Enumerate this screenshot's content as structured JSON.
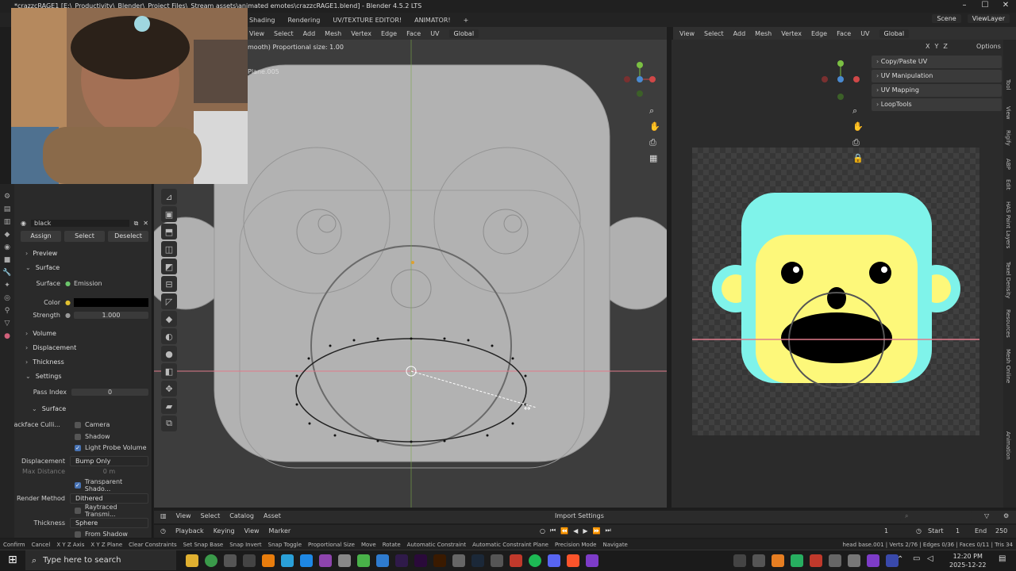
{
  "title_bar": {
    "title": "*crazzcRAGE1 [E:\\_Productivity\\_Blender\\_Project Files\\_Stream assets\\animated emotes\\crazzcRAGE1.blend] - Blender 4.5.2 LTS",
    "controls": [
      "–",
      "☐",
      "✕"
    ]
  },
  "workspace_tabs": [
    "Shading",
    "Rendering",
    "UV/TEXTURE EDITOR!",
    "ANIMATOR!",
    "+"
  ],
  "scene": {
    "scene": "Scene",
    "view_layer": "ViewLayer"
  },
  "viewport_header": {
    "items": [
      "View",
      "Select",
      "Add",
      "Mesh",
      "Vertex",
      "Edge",
      "Face",
      "UV"
    ],
    "orientation": "Global"
  },
  "viewport_info": {
    "proportional": "mooth) Proportional size: 1.00",
    "object": "Plane.005"
  },
  "uv_header": {
    "items": [
      "View",
      "Select",
      "Add",
      "Mesh",
      "Vertex",
      "Edge",
      "Face",
      "UV"
    ],
    "orientation": "Global",
    "options": "Options"
  },
  "uv_panel": {
    "items": [
      "Copy/Paste UV",
      "UV Manipulation",
      "UV Mapping",
      "LoopTools"
    ]
  },
  "uv_axes": [
    "X",
    "Y",
    "Z"
  ],
  "side_tabs": [
    "Tool",
    "View",
    "Rigify",
    "ABP",
    "Edit",
    "HAS Paint Layers",
    "Texel Density",
    "Resources",
    "Mesh Online",
    "Animation"
  ],
  "material": {
    "name": "black",
    "buttons": [
      "Assign",
      "Select",
      "Deselect"
    ],
    "preview": "Preview",
    "surface": "Surface",
    "surface_label": "Surface",
    "surface_value": "Emission",
    "color_label": "Color",
    "strength_label": "Strength",
    "strength_value": "1.000",
    "volume": "Volume",
    "displacement": "Displacement",
    "thickness": "Thickness",
    "settings": "Settings",
    "pass_index_label": "Pass Index",
    "pass_index_value": "0",
    "surface_sub": "Surface",
    "backface_label": "Backface Culli...",
    "camera": "Camera",
    "shadow": "Shadow",
    "light_probe": "Light Probe Volume",
    "displacement_label": "Displacement",
    "displacement_value": "Bump Only",
    "max_distance_label": "Max Distance",
    "max_distance_value": "0 m",
    "transparent_shadows": "Transparent Shado...",
    "render_method_label": "Render Method",
    "render_method_value": "Dithered",
    "raytraced": "Raytraced Transmi...",
    "thickness_label": "Thickness",
    "thickness_value": "Sphere",
    "from_shadow": "From Shadow"
  },
  "asset_header": {
    "items": [
      "View",
      "Select",
      "Catalog",
      "Asset"
    ],
    "import": "Import Settings"
  },
  "timeline": {
    "items": [
      "Playback",
      "Keying",
      "View",
      "Marker"
    ],
    "frame": "1",
    "start_label": "Start",
    "start": "1",
    "end_label": "End",
    "end": "250"
  },
  "status_bar": {
    "items": [
      "Confirm",
      "Cancel",
      "X Y Z Axis",
      "X Y Z Plane",
      "Clear Constraints",
      "Set Snap Base",
      "Snap Invert",
      "Snap Toggle",
      "Proportional Size",
      "Move",
      "Rotate",
      "Automatic Constraint",
      "Automatic Constraint Plane",
      "Precision Mode",
      "Navigate"
    ],
    "stats": "head base.001 | Verts 2/76 | Edges 0/36 | Faces 0/11 | Tris 34"
  },
  "taskbar": {
    "search_placeholder": "Type here to search",
    "time": "12:20 PM",
    "date": "2025-12-22"
  },
  "colors": {
    "face_cyan": "#7ff3ea",
    "face_yellow": "#fdf87a",
    "black": "#000000",
    "red_line": "#e07a8a",
    "accent_blue": "#4772b3"
  }
}
